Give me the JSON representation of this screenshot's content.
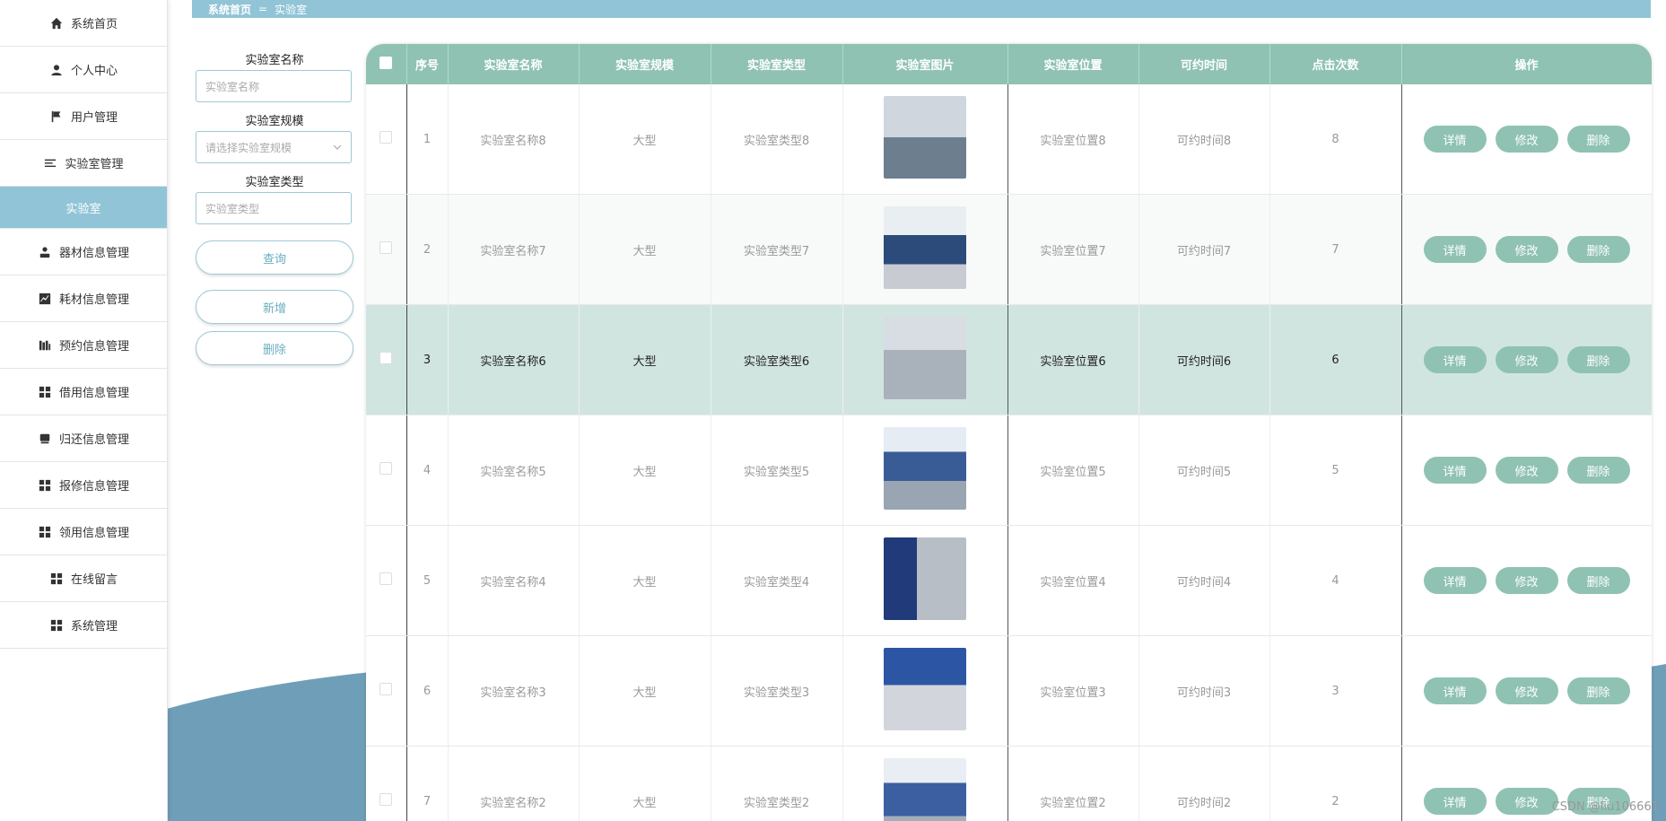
{
  "sidebar": {
    "items": [
      {
        "label": "系统首页",
        "icon": "home-icon"
      },
      {
        "label": "个人中心",
        "icon": "user-icon"
      },
      {
        "label": "用户管理",
        "icon": "flag-icon"
      },
      {
        "label": "实验室管理",
        "icon": "list-icon"
      },
      {
        "label": "实验室",
        "icon": ""
      },
      {
        "label": "器材信息管理",
        "icon": "person-icon"
      },
      {
        "label": "耗材信息管理",
        "icon": "chart-icon"
      },
      {
        "label": "预约信息管理",
        "icon": "bars-icon"
      },
      {
        "label": "借用信息管理",
        "icon": "grid-icon"
      },
      {
        "label": "归还信息管理",
        "icon": "box-icon"
      },
      {
        "label": "报修信息管理",
        "icon": "grid-icon"
      },
      {
        "label": "领用信息管理",
        "icon": "grid-icon"
      },
      {
        "label": "在线留言",
        "icon": "grid-icon"
      },
      {
        "label": "系统管理",
        "icon": "grid-icon"
      }
    ]
  },
  "breadcrumb": {
    "home": "系统首页",
    "sep": "=",
    "current": "实验室"
  },
  "search": {
    "name_label": "实验室名称",
    "name_placeholder": "实验室名称",
    "scale_label": "实验室规模",
    "scale_placeholder": "请选择实验室规模",
    "type_label": "实验室类型",
    "type_placeholder": "实验室类型",
    "query_btn": "查询",
    "add_btn": "新增",
    "delete_btn": "删除"
  },
  "table": {
    "headers": [
      "序号",
      "实验室名称",
      "实验室规模",
      "实验室类型",
      "实验室图片",
      "实验室位置",
      "可约时间",
      "点击次数",
      "操作"
    ],
    "ops": {
      "detail": "详情",
      "edit": "修改",
      "delete": "删除"
    },
    "rows": [
      {
        "no": "1",
        "name": "实验室名称8",
        "scale": "大型",
        "type": "实验室类型8",
        "location": "实验室位置8",
        "time": "可约时间8",
        "clicks": "8"
      },
      {
        "no": "2",
        "name": "实验室名称7",
        "scale": "大型",
        "type": "实验室类型7",
        "location": "实验室位置7",
        "time": "可约时间7",
        "clicks": "7"
      },
      {
        "no": "3",
        "name": "实验室名称6",
        "scale": "大型",
        "type": "实验室类型6",
        "location": "实验室位置6",
        "time": "可约时间6",
        "clicks": "6"
      },
      {
        "no": "4",
        "name": "实验室名称5",
        "scale": "大型",
        "type": "实验室类型5",
        "location": "实验室位置5",
        "time": "可约时间5",
        "clicks": "5"
      },
      {
        "no": "5",
        "name": "实验室名称4",
        "scale": "大型",
        "type": "实验室类型4",
        "location": "实验室位置4",
        "time": "可约时间4",
        "clicks": "4"
      },
      {
        "no": "6",
        "name": "实验室名称3",
        "scale": "大型",
        "type": "实验室类型3",
        "location": "实验室位置3",
        "time": "可约时间3",
        "clicks": "3"
      },
      {
        "no": "7",
        "name": "实验室名称2",
        "scale": "大型",
        "type": "实验室类型2",
        "location": "实验室位置2",
        "time": "可约时间2",
        "clicks": "2"
      }
    ]
  },
  "watermark": "CSDN @liu106661",
  "colors": {
    "accent": "#91c4d7",
    "table_head": "#8fc2b3",
    "highlight_row": "#d1e5e0",
    "wave": "#6f9fb8"
  }
}
